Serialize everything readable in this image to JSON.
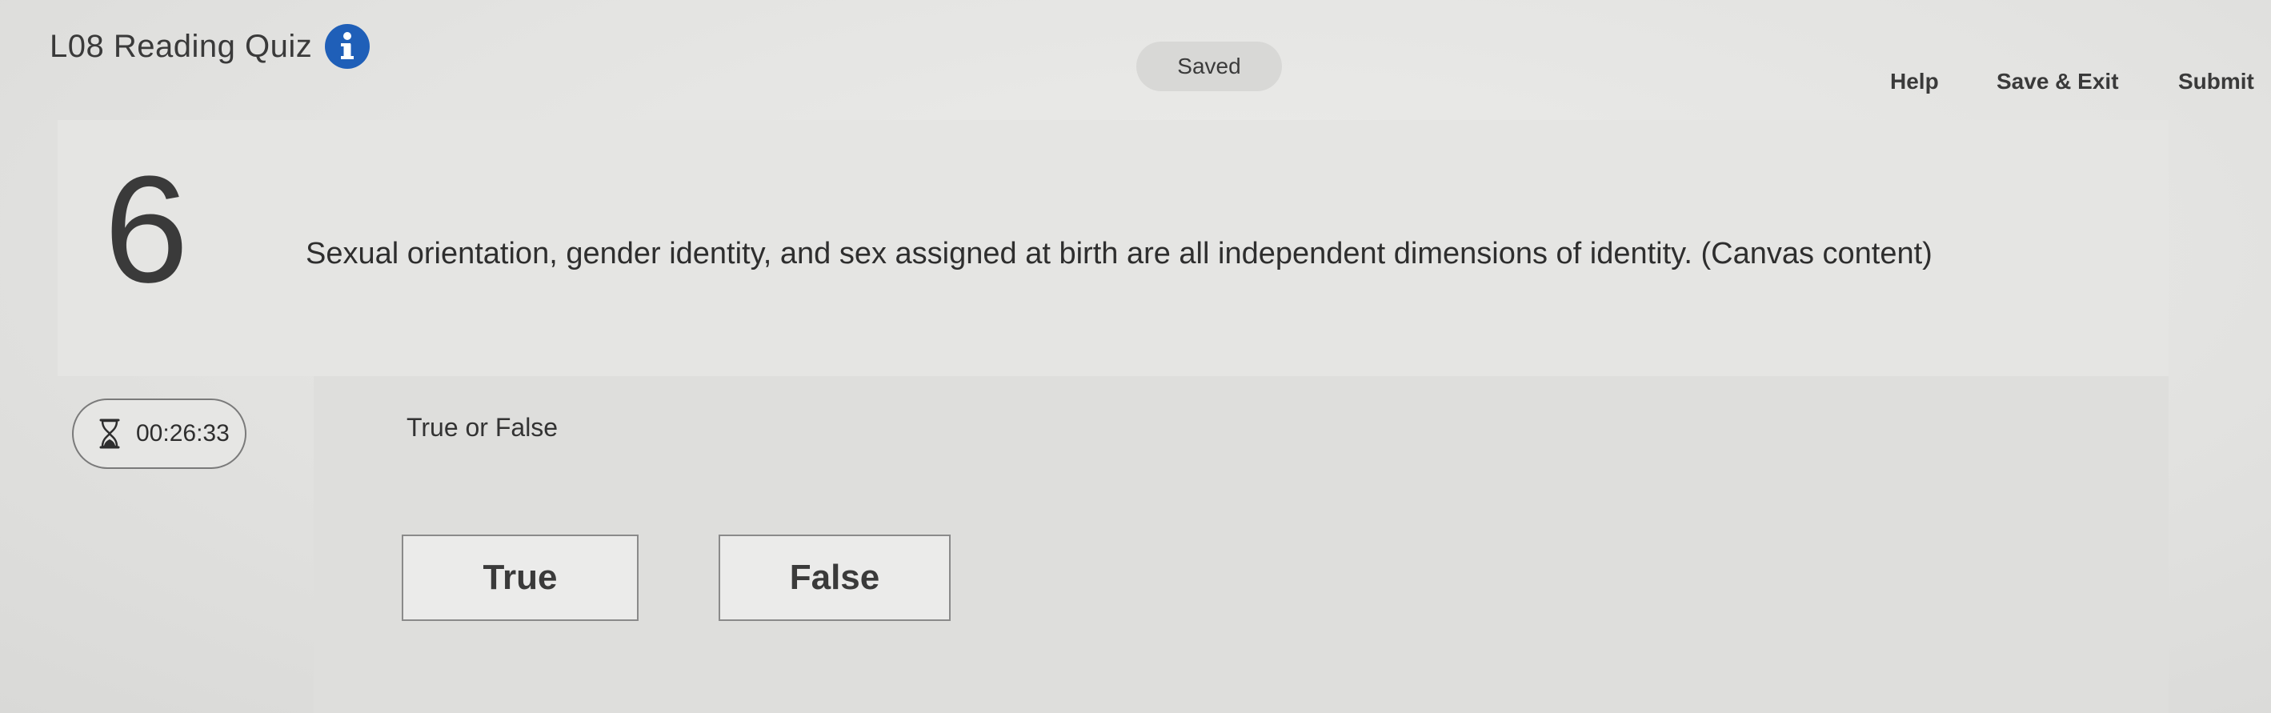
{
  "header": {
    "quiz_title": "L08 Reading Quiz",
    "status": "Saved",
    "nav": {
      "help": "Help",
      "save_exit": "Save & Exit",
      "submit": "Submit"
    }
  },
  "question": {
    "number": "6",
    "text": "Sexual orientation, gender identity, and sex assigned at birth are all independent dimensions of identity. (Canvas content)",
    "type_label": "True or False",
    "options": [
      "True",
      "False"
    ]
  },
  "timer": {
    "remaining": "00:26:33"
  },
  "icons": {
    "info": "info-icon",
    "timer": "hourglass-icon"
  },
  "colors": {
    "info_icon": "#1f5fb8"
  }
}
